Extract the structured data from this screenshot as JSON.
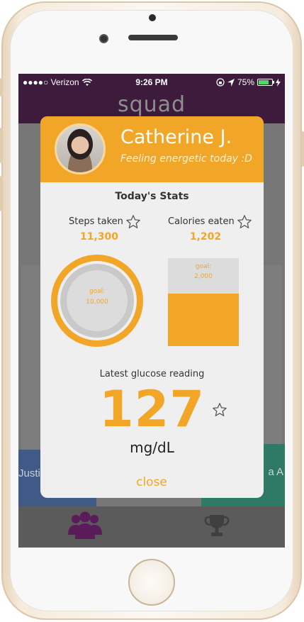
{
  "status_bar": {
    "carrier": "●●●●○ Verizon",
    "time": "9:26 PM",
    "battery": "75%",
    "battery_level": 0.75
  },
  "app": {
    "title": "squad"
  },
  "background": {
    "left_card_text": "Justi",
    "right_card_text": "a A"
  },
  "modal": {
    "user_name": "Catherine J.",
    "user_status": "Feeling energetic today :D",
    "stats_title": "Today's Stats",
    "steps": {
      "label": "Steps taken",
      "value": "11,300",
      "goal_label": "goal:",
      "goal": "10,000",
      "progress": 1.0
    },
    "calories": {
      "label": "Calories eaten",
      "value": "1,202",
      "goal_label": "goal:",
      "goal": "2,000",
      "progress": 0.6
    },
    "glucose": {
      "label": "Latest glucose reading",
      "value": "127",
      "unit": "mg/dL"
    },
    "close_label": "close"
  },
  "colors": {
    "accent": "#f2a628",
    "header": "#3d1b3c",
    "tab_active": "#5b1a5a"
  },
  "icons": [
    "wifi-icon",
    "location-icon",
    "lock-rotation-icon",
    "bluetooth-icon",
    "star-icon",
    "squad-group-icon",
    "trophy-icon"
  ]
}
